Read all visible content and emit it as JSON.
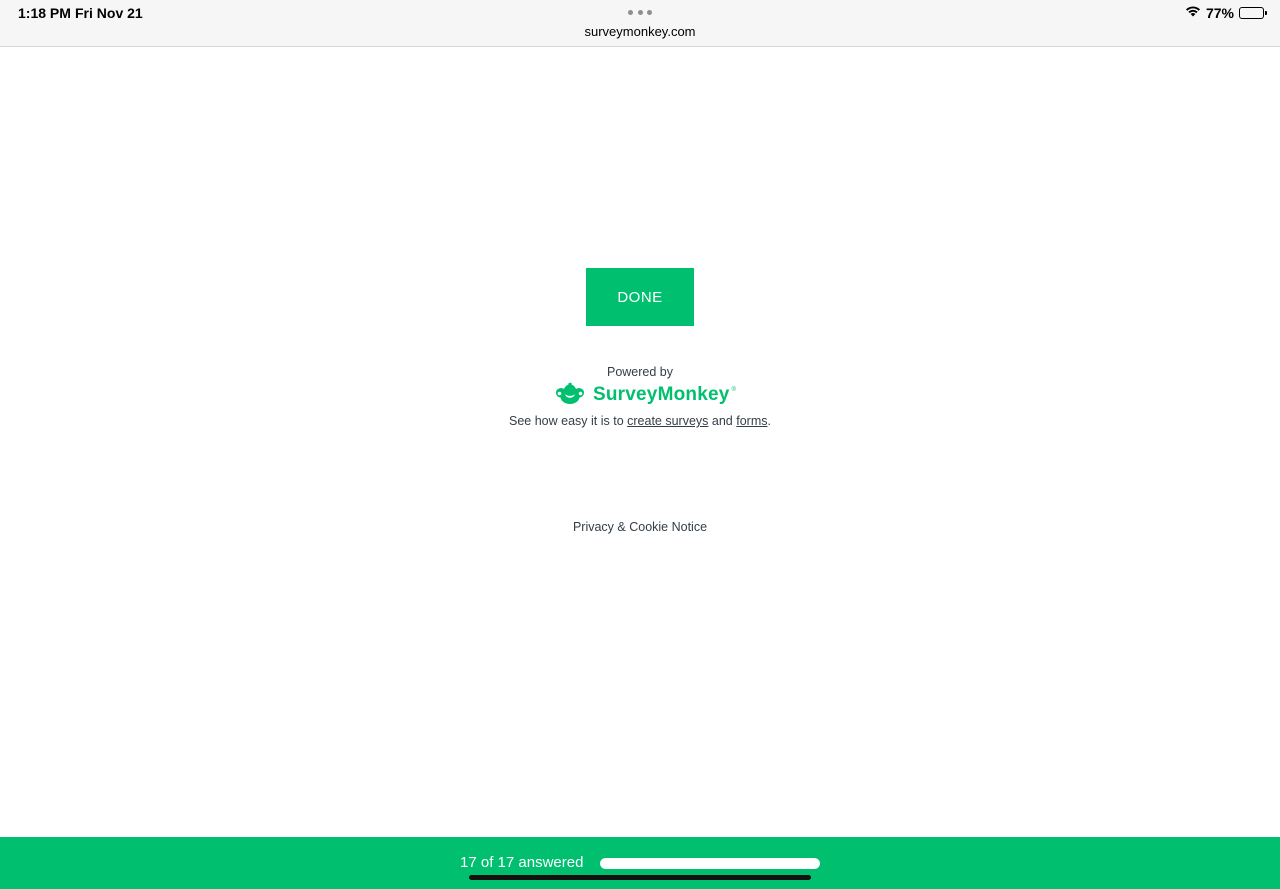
{
  "status_bar": {
    "time": "1:18 PM",
    "date": "Fri Nov 21",
    "battery": "77%",
    "battery_level": 0.77,
    "wifi_icon": "wifi-icon",
    "battery_icon": "battery-icon"
  },
  "browser": {
    "url": "surveymonkey.com",
    "menu_icon": "more-dots-icon"
  },
  "main": {
    "done_label": "DONE",
    "powered_by": "Powered by",
    "brand_name": "SurveyMonkey",
    "brand_mark": "®",
    "see_how_prefix": "See how easy it is to ",
    "create_surveys_link": "create surveys",
    "and_text": " and ",
    "forms_link": "forms",
    "period": ".",
    "privacy_link": "Privacy & Cookie Notice"
  },
  "footer": {
    "answered_text": "17 of 17 answered",
    "progress": 1.0
  },
  "colors": {
    "brand_green": "#00bf6f",
    "text": "#333e48"
  }
}
